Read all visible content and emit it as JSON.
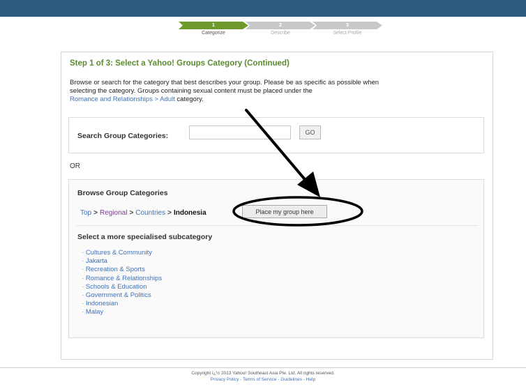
{
  "steps": [
    {
      "number": "1",
      "label": "Categorize",
      "state": "active"
    },
    {
      "number": "2",
      "label": "Describe",
      "state": "inactive"
    },
    {
      "number": "3",
      "label": "Select Profile",
      "state": "inactive"
    }
  ],
  "colors": {
    "topbar": "#2d5b80",
    "step_active": "#6d9a2b",
    "step_inactive": "#c8c8c8",
    "title_green": "#5b8b2f",
    "link_blue": "#3d72b8",
    "link_visited": "#7a3c8a"
  },
  "panel": {
    "title": "Step 1 of 3: Select a Yahoo! Groups Category (Continued)",
    "intro_line1": "Browse or search for the category that best describes your group. Please be as specific as possible when",
    "intro_line2": "selecting the category. Groups containing sexual content must be placed under the",
    "intro_link": "Romance and Relationships > Adult",
    "intro_tail": " category."
  },
  "search": {
    "label": "Search Group Categories:",
    "value": "",
    "placeholder": "",
    "go_label": "GO"
  },
  "or_label": "OR",
  "browse": {
    "title": "Browse Group Categories",
    "breadcrumb": {
      "top": "Top",
      "regional": "Regional",
      "countries": "Countries",
      "current": "Indonesia",
      "separator": ">"
    },
    "place_button": "Place my group here",
    "subcategory_title": "Select a more specialised subcategory",
    "subcategories": [
      "Cultures & Community",
      "Jakarta",
      "Recreation & Sports",
      "Romance & Relationships",
      "Schools & Education",
      "Government & Politics",
      "Indonesian",
      "Malay"
    ],
    "bullet": "·"
  },
  "annotation": {
    "arrow_icon": "black-arrow-icon",
    "ellipse_icon": "black-ellipse-highlight"
  },
  "footer": {
    "copyright": "Copyright ï¿½ 2013 Yahoo! Southeast Asia Pte. Ltd. All rights reserved.",
    "links": [
      "Privacy Policy",
      "Terms of Service",
      "Guidelines",
      "Help"
    ],
    "link_separator": "-"
  }
}
